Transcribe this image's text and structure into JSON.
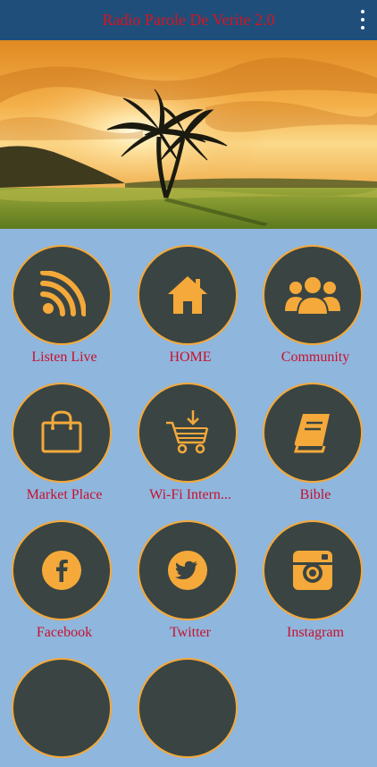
{
  "header": {
    "title": "Radio Parole De Verite 2.0",
    "menu_icon": "more-vertical-icon"
  },
  "banner": {
    "image": "palm-trees-sunset",
    "slides": 2,
    "active_slide": 1
  },
  "tiles": [
    {
      "label": "Listen Live",
      "icon": "rss-icon"
    },
    {
      "label": "HOME",
      "icon": "home-icon"
    },
    {
      "label": "Community",
      "icon": "users-icon"
    },
    {
      "label": "Market Place",
      "icon": "shopping-bag-icon"
    },
    {
      "label": "Wi-Fi Intern...",
      "icon": "cart-download-icon"
    },
    {
      "label": "Bible",
      "icon": "book-icon"
    },
    {
      "label": "Facebook",
      "icon": "facebook-icon"
    },
    {
      "label": "Twitter",
      "icon": "twitter-icon"
    },
    {
      "label": "Instagram",
      "icon": "instagram-icon"
    }
  ],
  "colors": {
    "topbar": "#1f4e7a",
    "title": "#d8141e",
    "background": "#8fb6dd",
    "tile_circle": "#3a4442",
    "tile_border": "#f4a93a",
    "icon": "#f4a93a",
    "label": "#c8102e"
  }
}
